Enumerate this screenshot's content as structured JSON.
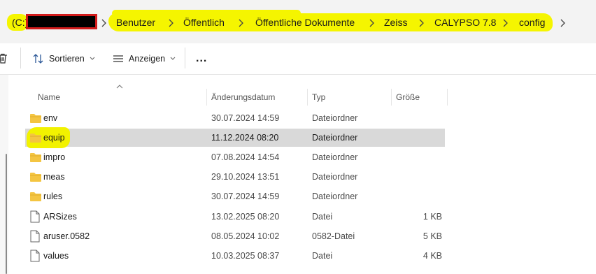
{
  "breadcrumb": {
    "drive_prefix": "(C:)",
    "items": [
      "Benutzer",
      "Öffentlich",
      "Öffentliche Dokumente",
      "Zeiss",
      "CALYPSO 7.8",
      "config"
    ]
  },
  "toolbar": {
    "sort_label": "Sortieren",
    "view_label": "Anzeigen",
    "more_label": "..."
  },
  "columns": {
    "name": "Name",
    "date": "Änderungsdatum",
    "type": "Typ",
    "size": "Größe"
  },
  "files": [
    {
      "name": "env",
      "date": "30.07.2024 14:59",
      "type": "Dateiordner",
      "size": "",
      "icon": "folder-icon"
    },
    {
      "name": "equip",
      "date": "11.12.2024 08:20",
      "type": "Dateiordner",
      "size": "",
      "icon": "folder-icon"
    },
    {
      "name": "impro",
      "date": "07.08.2024 14:54",
      "type": "Dateiordner",
      "size": "",
      "icon": "folder-icon"
    },
    {
      "name": "meas",
      "date": "29.10.2024 13:51",
      "type": "Dateiordner",
      "size": "",
      "icon": "folder-icon"
    },
    {
      "name": "rules",
      "date": "30.07.2024 14:59",
      "type": "Dateiordner",
      "size": "",
      "icon": "folder-icon"
    },
    {
      "name": "ARSizes",
      "date": "13.02.2025 08:20",
      "type": "Datei",
      "size": "1 KB",
      "icon": "file-icon"
    },
    {
      "name": "aruser.0582",
      "date": "08.05.2024 10:02",
      "type": "0582-Datei",
      "size": "5 KB",
      "icon": "file-icon"
    },
    {
      "name": "values",
      "date": "10.03.2025 08:37",
      "type": "Datei",
      "size": "4 KB",
      "icon": "file-icon"
    }
  ],
  "selected_index": 1,
  "colors": {
    "highlight": "#f5f500",
    "selection": "#d9d9d9",
    "folder": "#f4c542",
    "redaction_border": "#d21b1b"
  }
}
